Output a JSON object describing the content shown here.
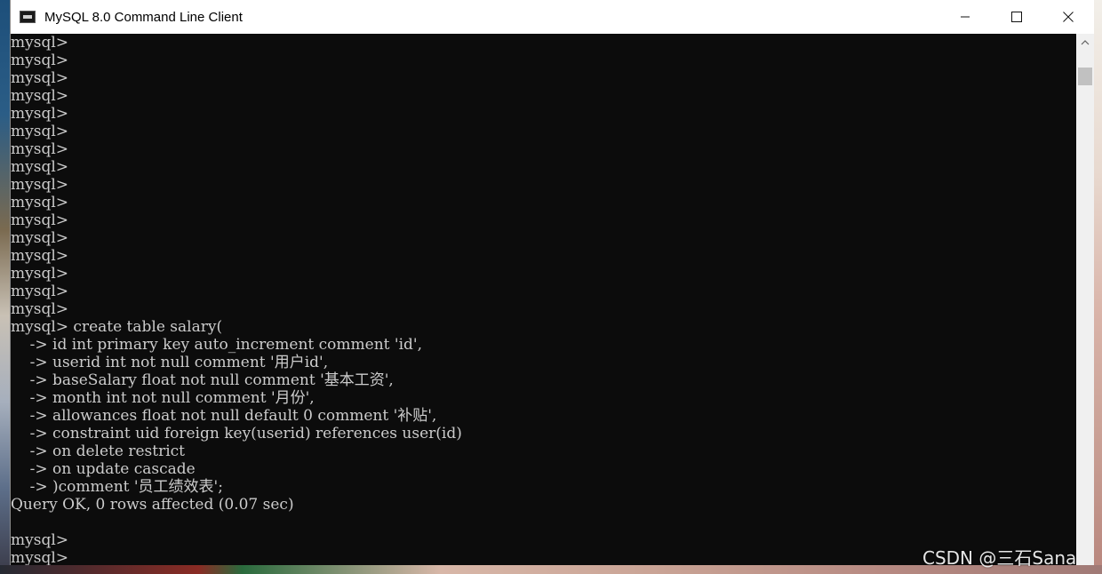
{
  "window": {
    "title": "MySQL 8.0 Command Line Client"
  },
  "controls": {
    "minimize_icon": "minimize-icon",
    "maximize_icon": "maximize-icon",
    "close_icon": "close-icon"
  },
  "console": {
    "lines": [
      "mysql>",
      "mysql>",
      "mysql>",
      "mysql>",
      "mysql>",
      "mysql>",
      "mysql>",
      "mysql>",
      "mysql>",
      "mysql>",
      "mysql>",
      "mysql>",
      "mysql>",
      "mysql>",
      "mysql>",
      "mysql>",
      "mysql> create table salary(",
      "    -> id int primary key auto_increment comment 'id',",
      "    -> userid int not null comment '用户id',",
      "    -> baseSalary float not null comment '基本工资',",
      "    -> month int not null comment '月份',",
      "    -> allowances float not null default 0 comment '补贴',",
      "    -> constraint uid foreign key(userid) references user(id)",
      "    -> on delete restrict",
      "    -> on update cascade",
      "    -> )comment '员工绩效表';",
      "Query OK, 0 rows affected (0.07 sec)",
      "",
      "mysql>",
      "mysql>"
    ]
  },
  "watermark": "CSDN @三石Sana",
  "colors": {
    "console_bg": "#0c0c0c",
    "console_text": "#cccccc",
    "titlebar_bg": "#ffffff"
  }
}
